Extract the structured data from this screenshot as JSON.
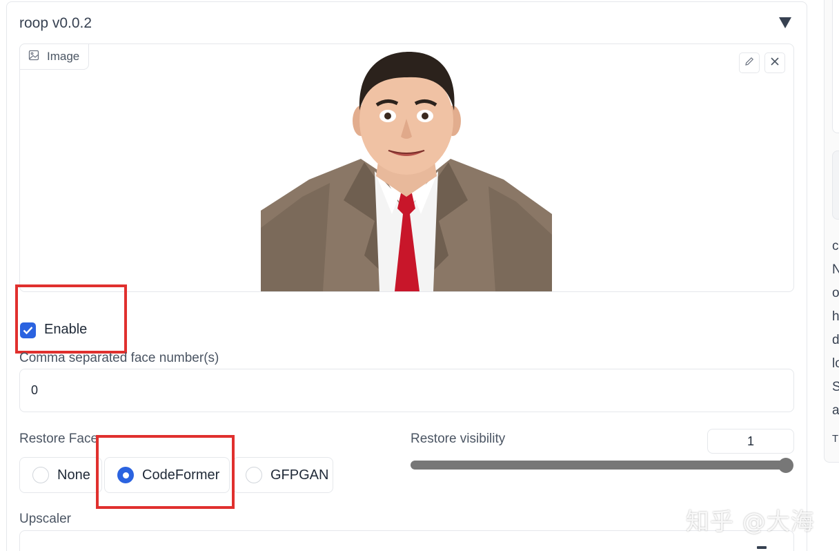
{
  "panel": {
    "title": "roop v0.0.2"
  },
  "image_panel": {
    "label": "Image"
  },
  "enable": {
    "label": "Enable",
    "checked": true
  },
  "face_numbers": {
    "label": "Comma separated face number(s)",
    "value": "0"
  },
  "restore_face": {
    "label": "Restore Face",
    "options": [
      "None",
      "CodeFormer",
      "GFPGAN"
    ],
    "selected": "CodeFormer"
  },
  "restore_visibility": {
    "label": "Restore visibility",
    "value": "1",
    "fraction": 1.0
  },
  "upscaler": {
    "label": "Upscaler"
  },
  "side_panel": {
    "letters": [
      "c",
      "N",
      "o",
      "h",
      "d",
      "lo",
      "S",
      "a",
      "T"
    ]
  },
  "watermark": "知乎 @大海",
  "colors": {
    "accent": "#2b63e0",
    "highlight": "#e0302e",
    "slider": "#777777"
  }
}
